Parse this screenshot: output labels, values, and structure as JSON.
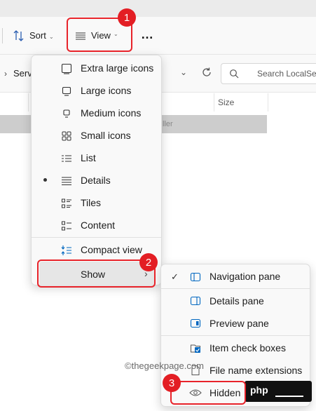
{
  "toolbar": {
    "sort_label": "Sort",
    "view_label": "View",
    "more_label": "…"
  },
  "address": {
    "path_text": "Servi",
    "search_placeholder": "Search LocalServ"
  },
  "columns": {
    "size_label": "Size"
  },
  "row": {
    "type_fragment": "ller"
  },
  "view_menu": {
    "items": [
      {
        "label": "Extra large icons",
        "icon": "extra-large-icons-icon"
      },
      {
        "label": "Large icons",
        "icon": "large-icons-icon"
      },
      {
        "label": "Medium icons",
        "icon": "medium-icons-icon"
      },
      {
        "label": "Small icons",
        "icon": "small-icons-icon"
      },
      {
        "label": "List",
        "icon": "list-icon"
      },
      {
        "label": "Details",
        "icon": "details-icon",
        "selected": true
      },
      {
        "label": "Tiles",
        "icon": "tiles-icon"
      },
      {
        "label": "Content",
        "icon": "content-icon"
      }
    ],
    "compact_label": "Compact view",
    "show_label": "Show"
  },
  "show_menu": {
    "items": [
      {
        "label": "Navigation pane",
        "icon": "navigation-pane-icon",
        "checked": true
      },
      {
        "label": "Details pane",
        "icon": "details-pane-icon"
      },
      {
        "label": "Preview pane",
        "icon": "preview-pane-icon"
      },
      {
        "label": "Item check boxes",
        "icon": "item-check-boxes-icon"
      },
      {
        "label": "File name extensions",
        "icon": "file-name-extensions-icon"
      },
      {
        "label": "Hidden items",
        "icon": "hidden-items-icon"
      }
    ]
  },
  "callouts": [
    "1",
    "2",
    "3"
  ],
  "watermark": "©thegeekpage.com",
  "colors": {
    "callout_red": "#e31e24",
    "accent_blue": "#0067c0"
  }
}
